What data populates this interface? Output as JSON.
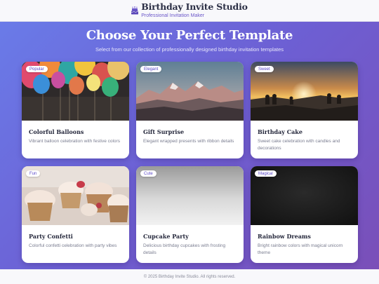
{
  "header": {
    "title": "Birthday Invite Studio",
    "subtitle": "Professional Invitation Maker",
    "icon": "cake-icon"
  },
  "hero": {
    "title": "Choose Your Perfect Template",
    "subtitle": "Select from our collection of professionally designed birthday invitation templates"
  },
  "templates": [
    {
      "badge": "Popular",
      "title": "Colorful Balloons",
      "description": "Vibrant balloon celebration with festive colors",
      "image": "balloons-photo"
    },
    {
      "badge": "Elegant",
      "title": "Gift Surprise",
      "description": "Elegant wrapped presents with ribbon details",
      "image": "mountain-photo"
    },
    {
      "badge": "Sweet",
      "title": "Birthday Cake",
      "description": "Sweet cake celebration with candles and decorations",
      "image": "sunset-photo"
    },
    {
      "badge": "Fun",
      "title": "Party Confetti",
      "description": "Colorful confetti celebration with party vibes",
      "image": "cupcakes-photo"
    },
    {
      "badge": "Cute",
      "title": "Cupcake Party",
      "description": "Delicious birthday cupcakes with frosting details",
      "image": "gray-gradient"
    },
    {
      "badge": "Magical",
      "title": "Rainbow Dreams",
      "description": "Bright rainbow colors with magical unicorn theme",
      "image": "dark-texture"
    }
  ],
  "footer": {
    "text": "© 2025 Birthday Invite Studio. All rights reserved."
  },
  "colors": {
    "accent": "#6b57c9",
    "gradient_start": "#6a7be8",
    "gradient_end": "#7a4fb8"
  }
}
